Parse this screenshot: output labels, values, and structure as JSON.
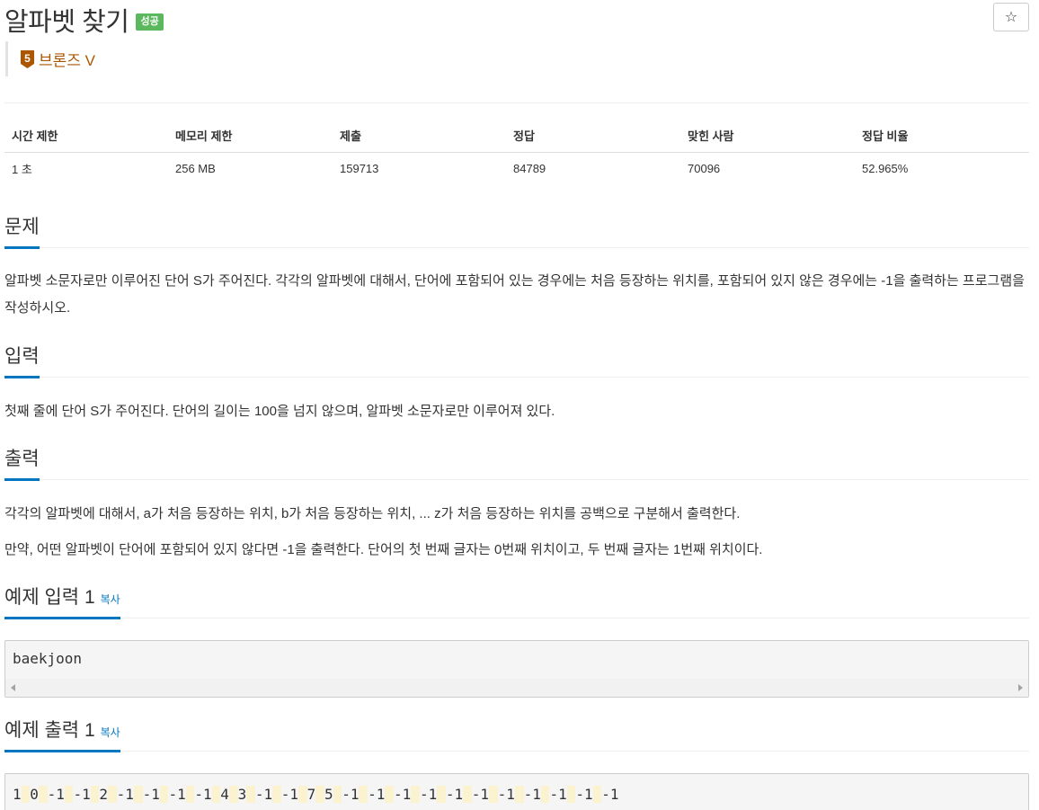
{
  "problem": {
    "title": "알파벳 찾기",
    "status_badge": "성공",
    "star_label": "☆",
    "tier_number": "5",
    "tier_label": "브론즈 V"
  },
  "info_table": {
    "headers": [
      "시간 제한",
      "메모리 제한",
      "제출",
      "정답",
      "맞힌 사람",
      "정답 비율"
    ],
    "values": [
      "1 초",
      "256 MB",
      "159713",
      "84789",
      "70096",
      "52.965%"
    ]
  },
  "sections": {
    "description": {
      "heading": "문제",
      "text": "알파벳 소문자로만 이루어진 단어 S가 주어진다. 각각의 알파벳에 대해서, 단어에 포함되어 있는 경우에는 처음 등장하는 위치를, 포함되어 있지 않은 경우에는 -1을 출력하는 프로그램을 작성하시오."
    },
    "input": {
      "heading": "입력",
      "text": "첫째 줄에 단어 S가 주어진다. 단어의 길이는 100을 넘지 않으며, 알파벳 소문자로만 이루어져 있다."
    },
    "output": {
      "heading": "출력",
      "text1": "각각의 알파벳에 대해서, a가 처음 등장하는 위치, b가 처음 등장하는 위치, ... z가 처음 등장하는 위치를 공백으로 구분해서 출력한다.",
      "text2": "만약, 어떤 알파벳이 단어에 포함되어 있지 않다면 -1을 출력한다. 단어의 첫 번째 글자는 0번째 위치이고, 두 번째 글자는 1번째 위치이다."
    },
    "sample_input": {
      "heading": "예제 입력 1",
      "copy_label": "복사",
      "content": "baekjoon"
    },
    "sample_output": {
      "heading": "예제 출력 1",
      "copy_label": "복사",
      "tokens": [
        "1",
        "0",
        "-1",
        "-1",
        "2",
        "-1",
        "-1",
        "-1",
        "-1",
        "4",
        "3",
        "-1",
        "-1",
        "7",
        "5",
        "-1",
        "-1",
        "-1",
        "-1",
        "-1",
        "-1",
        "-1",
        "-1",
        "-1",
        "-1",
        "-1"
      ]
    }
  },
  "colors": {
    "accent_blue": "#0076c0",
    "success_green": "#5cb85c",
    "bronze": "#ad5600",
    "whitespace_highlight": "#fbf2d0"
  }
}
